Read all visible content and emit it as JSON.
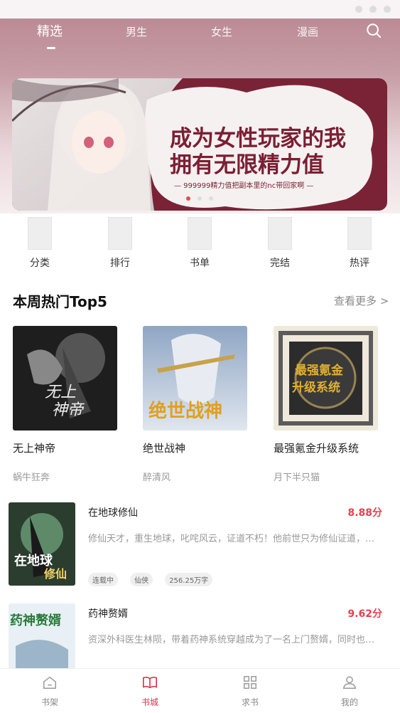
{
  "tabs": [
    {
      "label": "精选",
      "active": true
    },
    {
      "label": "男生",
      "active": false
    },
    {
      "label": "女生",
      "active": false
    },
    {
      "label": "漫画",
      "active": false
    }
  ],
  "banner": {
    "headline_line1": "成为女性玩家的我",
    "headline_line2": "拥有无限精力值",
    "subline": "— 999999精力值把副本里的nc带回家啊 —"
  },
  "quick_entries": [
    "分类",
    "排行",
    "书单",
    "完结",
    "热评"
  ],
  "hot_section": {
    "title": "本周热门Top5",
    "more": "查看更多 >"
  },
  "hot_books": [
    {
      "title": "无上神帝",
      "author": "蜗牛狂奔",
      "cover_text": "无上神帝"
    },
    {
      "title": "绝世战神",
      "author": "醉清风",
      "cover_text": "绝世战神"
    },
    {
      "title": "最强氪金升级系统",
      "author": "月下半只猫",
      "cover_text": "最强氪金升级系统"
    }
  ],
  "list_books": [
    {
      "title": "在地球修仙",
      "score": "8.88分",
      "desc": "修仙天才，重生地球，叱咤风云，证道不朽！他前世只为修仙证道，却...",
      "tags": [
        "连载中",
        "仙侠",
        "256.25万字"
      ],
      "cover_text": "在地球修仙"
    },
    {
      "title": "药神赘婿",
      "score": "9.62分",
      "desc": "资深外科医生林陨，带着药神系统穿越成为了一名上门赘婿，同时也拥...",
      "tags": [],
      "cover_text": "药神赘婿"
    }
  ],
  "bottom_nav": [
    {
      "label": "书架",
      "icon": "home-icon",
      "active": false
    },
    {
      "label": "书城",
      "icon": "book-icon",
      "active": true
    },
    {
      "label": "求书",
      "icon": "grid-icon",
      "active": false
    },
    {
      "label": "我的",
      "icon": "user-icon",
      "active": false
    }
  ],
  "colors": {
    "accent": "#d9334a",
    "score": "#e8404f"
  }
}
